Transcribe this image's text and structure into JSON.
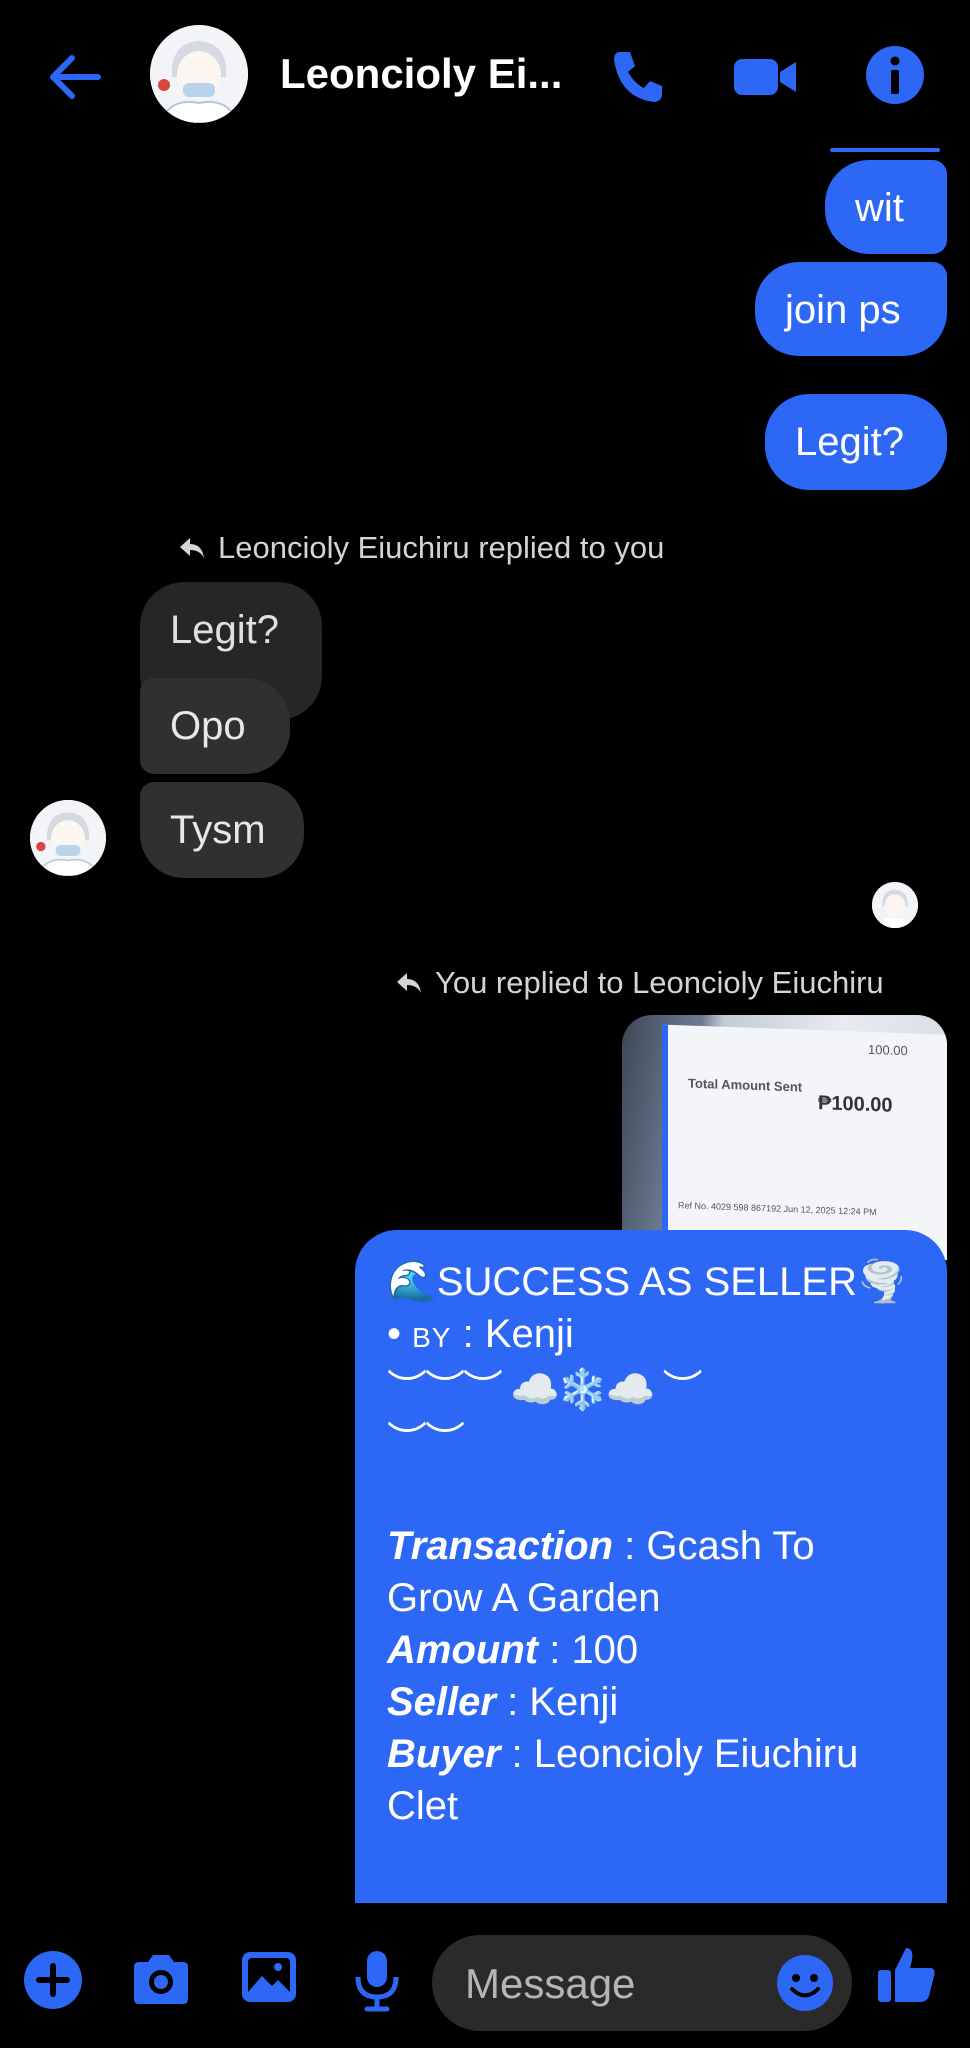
{
  "header": {
    "title": "Leoncioly Ei...",
    "icons": [
      "back-arrow-icon",
      "phone-icon",
      "video-icon",
      "info-icon"
    ],
    "accent": "#2d67f6"
  },
  "messages": {
    "out_1": "wit",
    "out_2": "join ps",
    "out_3": "Legit?",
    "reply_note_1": "Leoncioly Eiuchiru replied to you",
    "in_quoted": "Legit?",
    "in_1": "Opo",
    "in_2": "Tysm",
    "reply_note_2": "You replied to Leoncioly Eiuchiru"
  },
  "image_preview": {
    "amount_top": "100.00",
    "total_label": "Total Amount Sent",
    "total_value": "₱100.00",
    "ref_text": "Ref No. 4029 598 867192 Jun 12, 2025 12:24 PM"
  },
  "big_message": {
    "line1": "🌊SUCCESS AS SELLER🌪️",
    "by_bullet": "• ",
    "by_label": "BY",
    "by_value": " : Kenji",
    "deco1": "︶︶︶ ☁️❄️☁️ ︶",
    "deco2": "︶︶",
    "transaction_label": "Transaction",
    "transaction_value": " : Gcash To",
    "transaction_value2": "Grow A Garden",
    "amount_label": "Amount",
    "amount_value": " : 100",
    "seller_label": "Seller",
    "seller_value": " : Kenji",
    "buyer_label": "Buyer",
    "buyer_value": " : Leoncioly Eiuchiru",
    "buyer_value2": "Clet"
  },
  "composer": {
    "placeholder": "Message",
    "icons": [
      "plus-icon",
      "camera-icon",
      "gallery-icon",
      "microphone-icon",
      "emoji-icon",
      "thumbs-up-icon"
    ]
  }
}
